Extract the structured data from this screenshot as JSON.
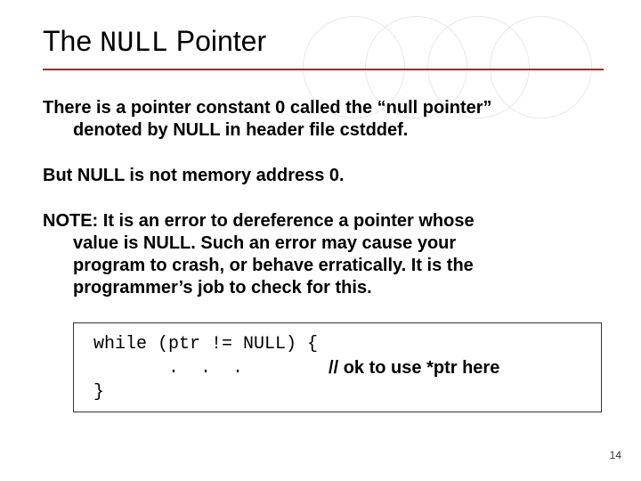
{
  "title": {
    "word1": "The",
    "code": "NULL",
    "word2": "Pointer"
  },
  "para1_line1": "There is a pointer constant 0 called the “null pointer”",
  "para1_line2": "denoted by NULL in header file cstddef.",
  "para2": "But NULL is not memory address 0.",
  "para3_line1": "NOTE:  It is an error to dereference a pointer whose",
  "para3_line2": "value is NULL.  Such an error may cause your",
  "para3_line3": "program to crash, or behave erratically.   It is the",
  "para3_line4": "programmer’s job to check for this.",
  "code": {
    "row1": "while (ptr != NULL) {",
    "row2_dots": "       .  .  .        ",
    "row2_comment": "// ok to use *ptr here",
    "row3": "}"
  },
  "page_number": "14"
}
